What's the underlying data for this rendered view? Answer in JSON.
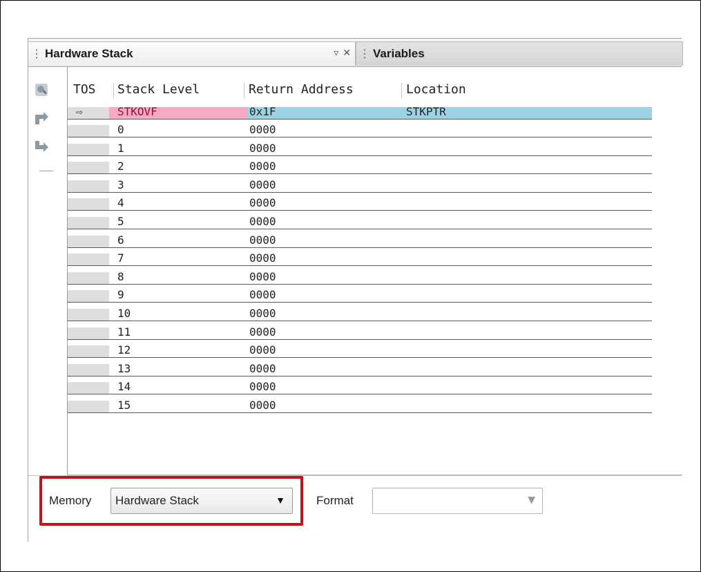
{
  "tabs": {
    "active": "Hardware Stack",
    "inactive": "Variables",
    "grip": "⋮"
  },
  "toolbar": {
    "icons": [
      "watch-icon",
      "step-into-icon",
      "step-out-icon"
    ]
  },
  "table": {
    "columns": [
      "TOS",
      "Stack Level",
      "Return Address",
      "Location"
    ],
    "selected_row": {
      "tos_marker": "⇨",
      "level": "STKOVF",
      "address": "0x1F",
      "location": "STKPTR"
    },
    "rows": [
      {
        "level": "0",
        "address": "0000"
      },
      {
        "level": "1",
        "address": "0000"
      },
      {
        "level": "2",
        "address": "0000"
      },
      {
        "level": "3",
        "address": "0000"
      },
      {
        "level": "4",
        "address": "0000"
      },
      {
        "level": "5",
        "address": "0000"
      },
      {
        "level": "6",
        "address": "0000"
      },
      {
        "level": "7",
        "address": "0000"
      },
      {
        "level": "8",
        "address": "0000"
      },
      {
        "level": "9",
        "address": "0000"
      },
      {
        "level": "10",
        "address": "0000"
      },
      {
        "level": "11",
        "address": "0000"
      },
      {
        "level": "12",
        "address": "0000"
      },
      {
        "level": "13",
        "address": "0000"
      },
      {
        "level": "14",
        "address": "0000"
      },
      {
        "level": "15",
        "address": "0000"
      }
    ]
  },
  "bottom": {
    "memory_label": "Memory",
    "memory_value": "Hardware Stack",
    "format_label": "Format",
    "format_value": ""
  },
  "colors": {
    "highlight": "#c0141c",
    "selected_level_bg": "#f5a9c5",
    "selected_row_bg": "#9bd4e6"
  }
}
